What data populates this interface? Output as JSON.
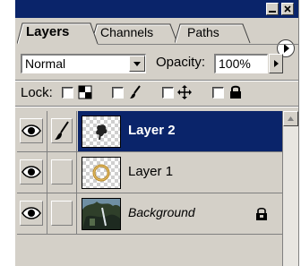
{
  "tabs": [
    {
      "label": "Layers",
      "active": true
    },
    {
      "label": "Channels",
      "active": false
    },
    {
      "label": "Paths",
      "active": false
    }
  ],
  "blend_mode": {
    "value": "Normal"
  },
  "opacity": {
    "label": "Opacity:",
    "value": "100%"
  },
  "lock": {
    "label": "Lock:",
    "icons": [
      "transparency-icon",
      "brush-icon",
      "move-icon",
      "lock-icon"
    ]
  },
  "layers": [
    {
      "name": "Layer 2",
      "selected": true,
      "visible": true,
      "linked_icon": "brush-icon"
    },
    {
      "name": "Layer 1",
      "selected": false,
      "visible": true
    },
    {
      "name": "Background",
      "selected": false,
      "visible": true,
      "locked": true
    }
  ],
  "colors": {
    "selection": "#0a246a",
    "panel": "#d4d0c8",
    "titlebar": "#0a246a"
  }
}
